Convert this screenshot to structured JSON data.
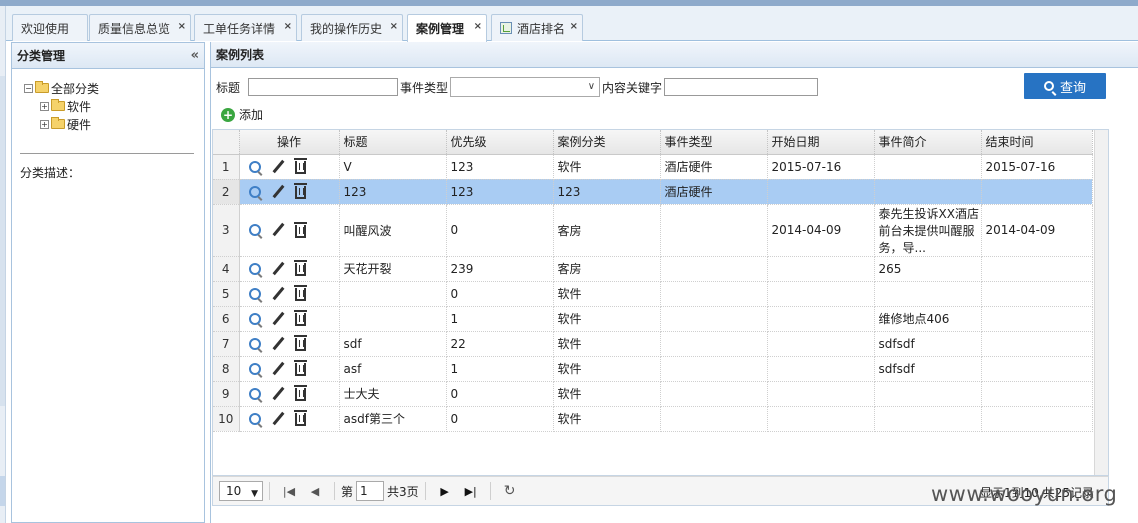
{
  "tabs": [
    {
      "label": "欢迎使用",
      "closable": false,
      "active": false
    },
    {
      "label": "质量信息总览",
      "closable": true,
      "active": false
    },
    {
      "label": "工单任务详情",
      "closable": true,
      "active": false
    },
    {
      "label": "我的操作历史",
      "closable": true,
      "active": false
    },
    {
      "label": "案例管理",
      "closable": true,
      "active": true
    },
    {
      "label": "酒店排名",
      "closable": true,
      "active": false,
      "icon": "table-icon"
    }
  ],
  "close_glyph": "×",
  "left_panel": {
    "title": "分类管理",
    "collapse_glyph": "«",
    "tree": {
      "root": "全部分类",
      "children": [
        "软件",
        "硬件"
      ]
    },
    "desc_label": "分类描述："
  },
  "main": {
    "title": "案例列表",
    "search": {
      "title_label": "标题",
      "title_value": "",
      "event_type_label": "事件类型",
      "event_type_value": "",
      "keyword_label": "内容关键字",
      "keyword_value": "",
      "query_button": "查询"
    },
    "add_label": "添加",
    "columns": [
      "操作",
      "标题",
      "优先级",
      "案例分类",
      "事件类型",
      "开始日期",
      "事件简介",
      "结束时间"
    ],
    "rows": [
      {
        "no": "1",
        "title": "V",
        "priority": "123",
        "category": "软件",
        "event_type": "酒店硬件",
        "start": "2015-07-16",
        "summary": "",
        "end": "2015-07-16",
        "selected": false
      },
      {
        "no": "2",
        "title": "123",
        "priority": "123",
        "category": "123",
        "event_type": "酒店硬件",
        "start": "",
        "summary": "",
        "end": "",
        "selected": true
      },
      {
        "no": "3",
        "title": "叫醒风波",
        "priority": "0",
        "category": "客房",
        "event_type": "",
        "start": "2014-04-09",
        "summary": "泰先生投诉XX酒店前台未提供叫醒服务，导...",
        "end": "2014-04-09",
        "selected": false
      },
      {
        "no": "4",
        "title": "天花开裂",
        "priority": "239",
        "category": "客房",
        "event_type": "",
        "start": "",
        "summary": "265",
        "end": "",
        "selected": false
      },
      {
        "no": "5",
        "title": "",
        "priority": "0",
        "category": "软件",
        "event_type": "",
        "start": "",
        "summary": "",
        "end": "",
        "selected": false
      },
      {
        "no": "6",
        "title": "",
        "priority": "1",
        "category": "软件",
        "event_type": "",
        "start": "",
        "summary": "维修地点406",
        "end": "",
        "selected": false
      },
      {
        "no": "7",
        "title": "sdf",
        "priority": "22",
        "category": "软件",
        "event_type": "",
        "start": "",
        "summary": "sdfsdf",
        "end": "",
        "selected": false
      },
      {
        "no": "8",
        "title": "asf",
        "priority": "1",
        "category": "软件",
        "event_type": "",
        "start": "",
        "summary": "sdfsdf",
        "end": "",
        "selected": false
      },
      {
        "no": "9",
        "title": "士大夫",
        "priority": "0",
        "category": "软件",
        "event_type": "",
        "start": "",
        "summary": "",
        "end": "",
        "selected": false
      },
      {
        "no": "10",
        "title": "asdf第三个",
        "priority": "0",
        "category": "软件",
        "event_type": "",
        "start": "",
        "summary": "",
        "end": "",
        "selected": false
      }
    ],
    "pager": {
      "page_size": "10",
      "page_prefix": "第",
      "page_value": "1",
      "page_suffix": "共3页",
      "info": "显示1到10,共25记录"
    }
  },
  "watermark": "www.wooyun.org",
  "colors": {
    "accent": "#2773c3",
    "selected_row": "#a9ccf3",
    "add_icon": "#3aa640"
  }
}
